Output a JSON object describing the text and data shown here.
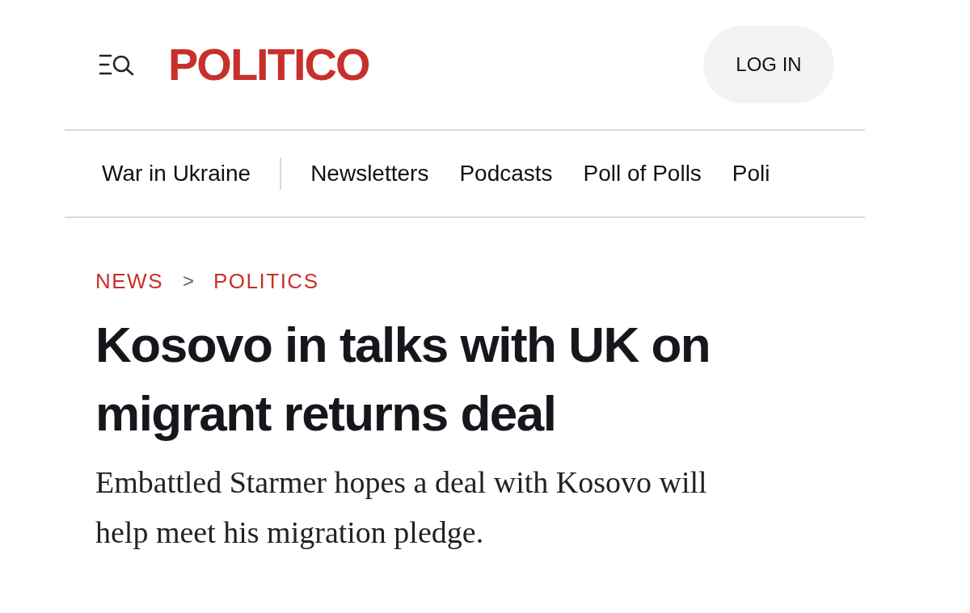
{
  "header": {
    "logo": "POLITICO",
    "login_button": "LOG IN"
  },
  "nav": [
    {
      "label": "War in Ukraine"
    },
    {
      "label": "Newsletters"
    },
    {
      "label": "Podcasts"
    },
    {
      "label": "Poll of Polls"
    },
    {
      "label": "Poli"
    }
  ],
  "breadcrumb": [
    "NEWS",
    "POLITICS"
  ],
  "breadcrumb_separator": ">",
  "headline": "Kosovo in talks with UK on migrant returns deal",
  "subheadline": "Embattled Starmer hopes a deal with Kosovo will help meet his migration pledge."
}
